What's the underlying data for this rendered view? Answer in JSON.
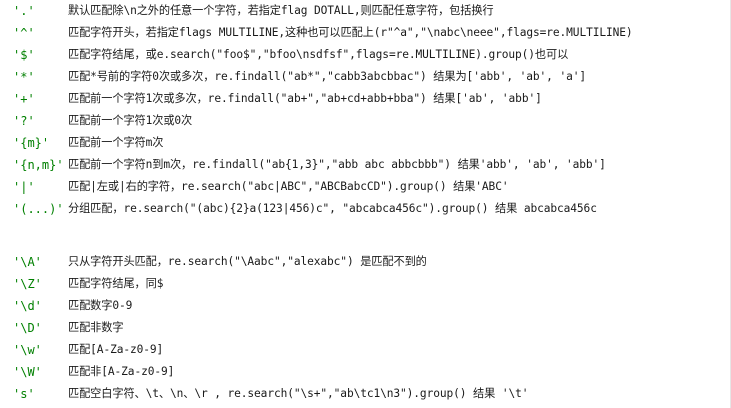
{
  "rows_group1": [
    {
      "symbol": "'.'",
      "description": "默认匹配除\\n之外的任意一个字符，若指定flag DOTALL,则匹配任意字符，包括换行"
    },
    {
      "symbol": "'^'",
      "description": "匹配字符开头，若指定flags MULTILINE,这种也可以匹配上(r\"^a\",\"\\nabc\\neee\",flags=re.MULTILINE)"
    },
    {
      "symbol": "'$'",
      "description": "匹配字符结尾，或e.search(\"foo$\",\"bfoo\\nsdfsf\",flags=re.MULTILINE).group()也可以"
    },
    {
      "symbol": "'*'",
      "description": "匹配*号前的字符0次或多次，re.findall(\"ab*\",\"cabb3abcbbac\")  结果为['abb', 'ab', 'a']"
    },
    {
      "symbol": "'+'",
      "description": "匹配前一个字符1次或多次，re.findall(\"ab+\",\"ab+cd+abb+bba\") 结果['ab', 'abb']"
    },
    {
      "symbol": "'?'",
      "description": "匹配前一个字符1次或0次"
    },
    {
      "symbol": "'{m}'",
      "description": "匹配前一个字符m次"
    },
    {
      "symbol": "'{n,m}'",
      "description": "匹配前一个字符n到m次，re.findall(\"ab{1,3}\",\"abb abc abbcbbb\") 结果'abb', 'ab', 'abb']"
    },
    {
      "symbol": "'|'",
      "description": "匹配|左或|右的字符，re.search(\"abc|ABC\",\"ABCBabcCD\").group() 结果'ABC'"
    },
    {
      "symbol": "'(...)'",
      "description": "分组匹配，re.search(\"(abc){2}a(123|456)c\", \"abcabca456c\").group() 结果 abcabca456c"
    }
  ],
  "rows_group2": [
    {
      "symbol": "'\\A'",
      "description": "只从字符开头匹配，re.search(\"\\Aabc\",\"alexabc\") 是匹配不到的"
    },
    {
      "symbol": "'\\Z'",
      "description": "匹配字符结尾，同$"
    },
    {
      "symbol": "'\\d'",
      "description": "匹配数字0-9"
    },
    {
      "symbol": "'\\D'",
      "description": "匹配非数字"
    },
    {
      "symbol": "'\\w'",
      "description": "匹配[A-Za-z0-9]"
    },
    {
      "symbol": "'\\W'",
      "description": "匹配非[A-Za-z0-9]"
    },
    {
      "symbol": "'s'",
      "description": "匹配空白字符、\\t、\\n、\\r , re.search(\"\\s+\",\"ab\\tc1\\n3\").group() 结果 '\\t'"
    }
  ]
}
